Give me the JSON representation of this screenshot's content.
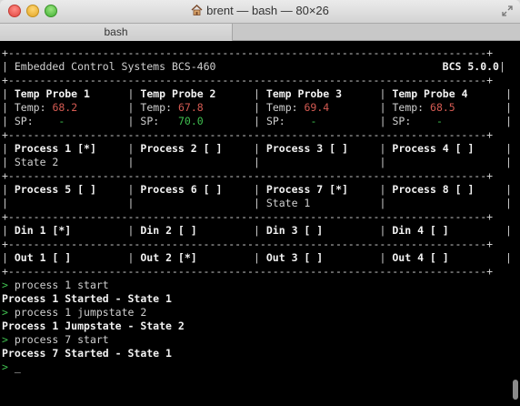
{
  "window": {
    "title": "brent — bash — 80×26",
    "tab": "bash"
  },
  "terminal": {
    "border": "+----------------------------------------------------------------------------+",
    "header": {
      "left": "Embedded Control Systems BCS-460",
      "right": "BCS 5.0.0"
    },
    "probes": [
      {
        "name": "Temp Probe 1",
        "temp_label": "Temp:",
        "temp": "68.2",
        "sp_label": "SP:",
        "sp": "-"
      },
      {
        "name": "Temp Probe 2",
        "temp_label": "Temp:",
        "temp": "67.8",
        "sp_label": "SP:",
        "sp": "70.0"
      },
      {
        "name": "Temp Probe 3",
        "temp_label": "Temp:",
        "temp": "69.4",
        "sp_label": "SP:",
        "sp": "-"
      },
      {
        "name": "Temp Probe 4",
        "temp_label": "Temp:",
        "temp": "68.5",
        "sp_label": "SP:",
        "sp": "-"
      }
    ],
    "process_rows": [
      [
        {
          "label": "Process 1 [*]",
          "state": "State 2"
        },
        {
          "label": "Process 2 [ ]",
          "state": ""
        },
        {
          "label": "Process 3 [ ]",
          "state": ""
        },
        {
          "label": "Process 4 [ ]",
          "state": ""
        }
      ],
      [
        {
          "label": "Process 5 [ ]",
          "state": ""
        },
        {
          "label": "Process 6 [ ]",
          "state": ""
        },
        {
          "label": "Process 7 [*]",
          "state": "State 1"
        },
        {
          "label": "Process 8 [ ]",
          "state": ""
        }
      ]
    ],
    "din": [
      "Din 1 [*]",
      "Din 2 [ ]",
      "Din 3 [ ]",
      "Din 4 [ ]"
    ],
    "out": [
      "Out 1 [ ]",
      "Out 2 [*]",
      "Out 3 [ ]",
      "Out 4 [ ]"
    ],
    "prompt_symbol": ">",
    "history": [
      {
        "command": "process 1 start",
        "response": "Process 1 Started - State 1"
      },
      {
        "command": "process 1 jumpstate 2",
        "response": "Process 1 Jumpstate - State 2"
      },
      {
        "command": "process 7 start",
        "response": "Process 7 Started - State 1"
      }
    ],
    "cursor": "_"
  },
  "colors": {
    "temp": "#d45a52",
    "setpoint": "#3fbf4f",
    "prompt": "#3fbf4f",
    "background": "#000000"
  }
}
